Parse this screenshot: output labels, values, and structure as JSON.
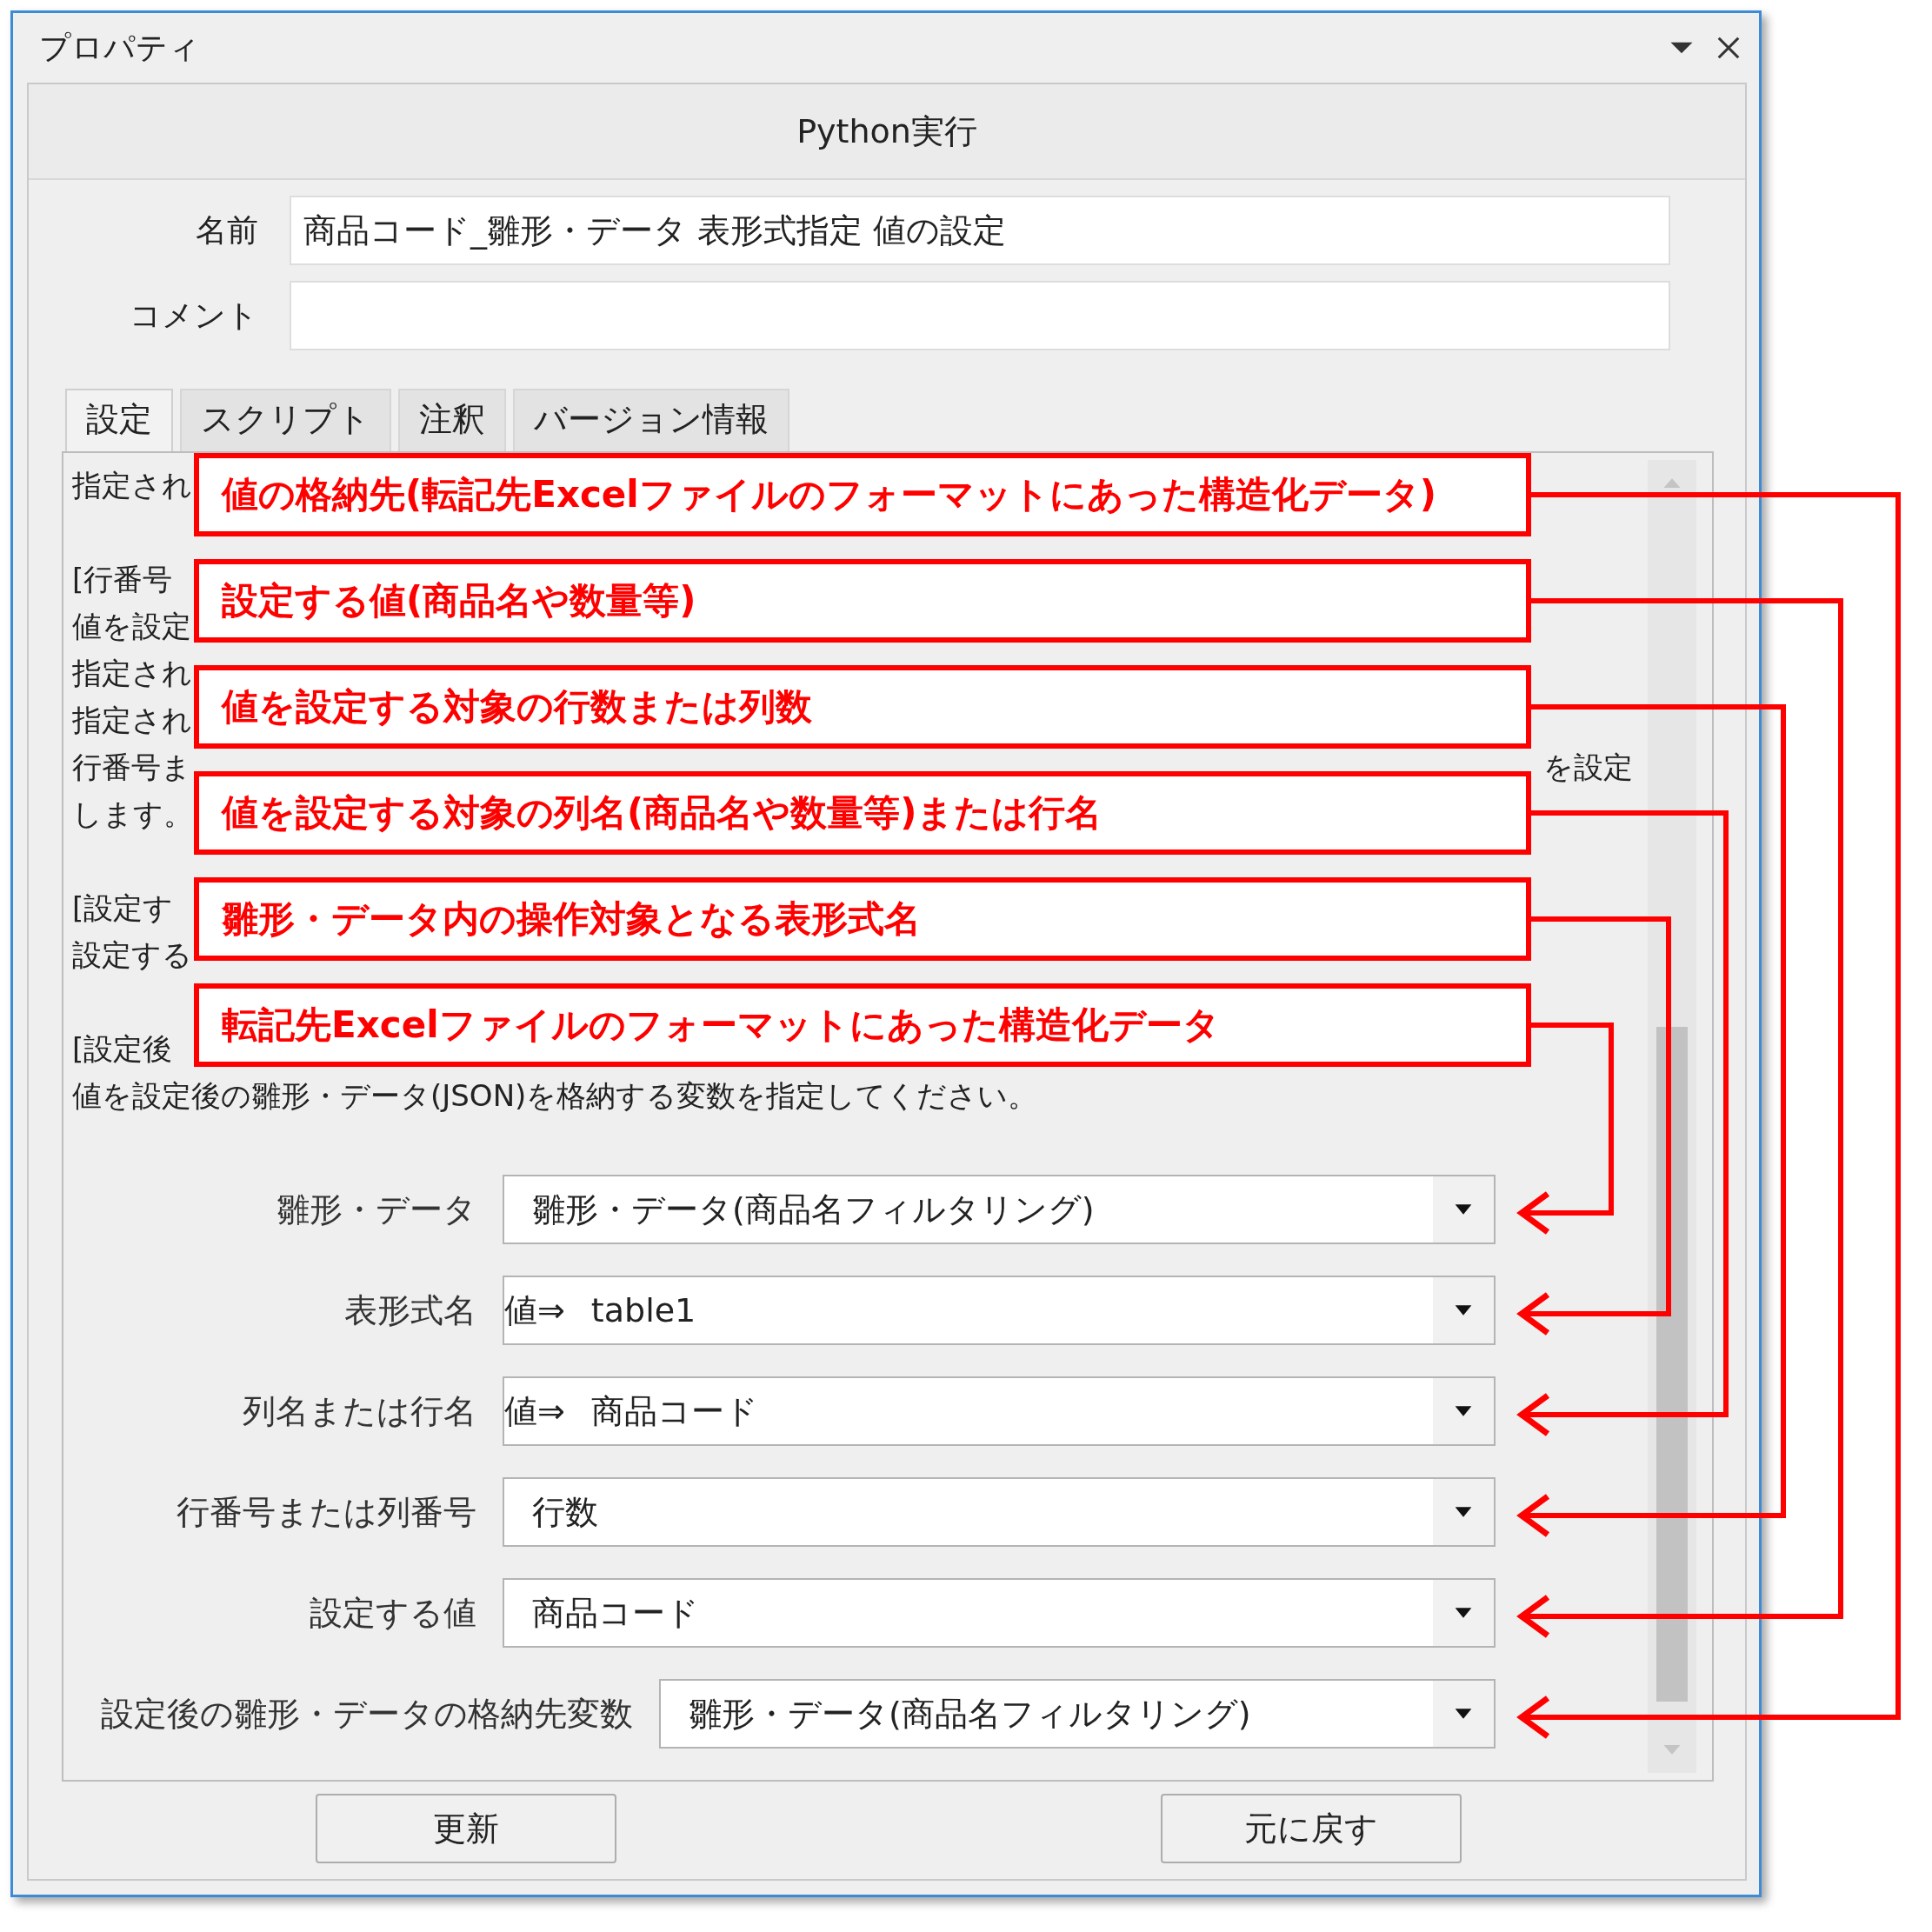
{
  "window": {
    "title": "プロパティ"
  },
  "header": "Python実行",
  "name_field": {
    "label": "名前",
    "value": "商品コード_雛形・データ 表形式指定 値の設定"
  },
  "comment_field": {
    "label": "コメント"
  },
  "tabs": [
    {
      "label": "設定",
      "selected": true
    },
    {
      "label": "スクリプト",
      "selected": false
    },
    {
      "label": "注釈",
      "selected": false
    },
    {
      "label": "バージョン情報",
      "selected": false
    }
  ],
  "description": [
    [
      {
        "text": "指定され"
      }
    ],
    [
      {
        "text": "[行番号"
      },
      {
        "text": "値を設定"
      },
      {
        "text": "指定され"
      },
      {
        "text": "指定され"
      },
      {
        "text": "行番号ま",
        "end": "を設定"
      },
      {
        "text": "します。"
      }
    ],
    [
      {
        "text": "[設定す"
      },
      {
        "text": "設定する"
      }
    ],
    [
      {
        "text": "[設定後"
      },
      {
        "text": "値を設定後の雛形・データ(JSON)を格納する変数を指定してください。"
      }
    ]
  ],
  "fields": [
    {
      "label": "雛形・データ",
      "value": "雛形・データ(商品名フィルタリング)"
    },
    {
      "label": "表形式名",
      "prefix": "値⇒",
      "value": "table1"
    },
    {
      "label": "列名または行名",
      "prefix": "値⇒",
      "value": "商品コード"
    },
    {
      "label": "行番号または列番号",
      "value": "行数"
    },
    {
      "label": "設定する値",
      "value": "商品コード"
    },
    {
      "label": "設定後の雛形・データの格納先変数",
      "value": "雛形・データ(商品名フィルタリング)"
    }
  ],
  "buttons": [
    "更新",
    "元に戻す"
  ],
  "annotations": [
    "値の格納先(転記先Excelファイルのフォーマットにあった構造化データ)",
    "設定する値(商品名や数量等)",
    "値を設定する対象の行数または列数",
    "値を設定する対象の列名(商品名や数量等)または行名",
    "雛形・データ内の操作対象となる表形式名",
    "転記先Excelファイルのフォーマットにあった構造化データ"
  ]
}
